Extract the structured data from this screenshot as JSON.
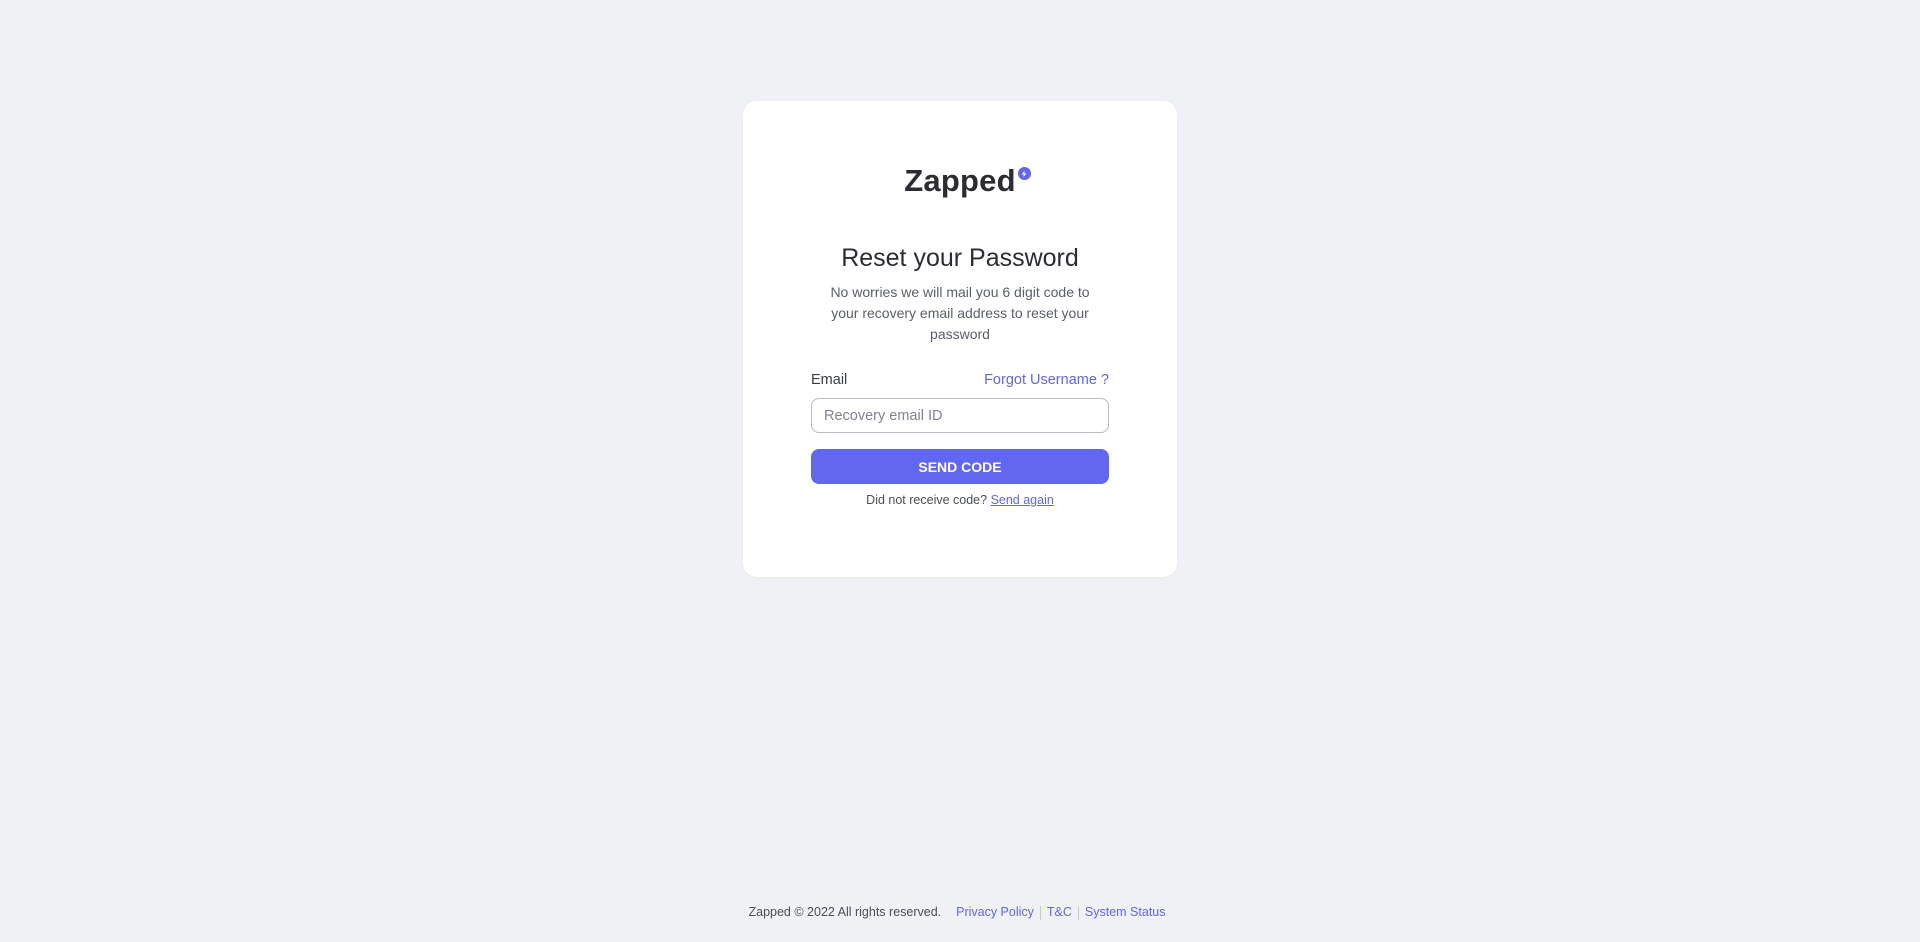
{
  "brand": {
    "name": "Zapped",
    "badge_icon": "bolt-icon",
    "accent": "#6267ea"
  },
  "reset": {
    "title": "Reset your Password",
    "description": "No worries we will mail you 6 digit code to your recovery email address to reset your password",
    "email_label": "Email",
    "forgot_username": "Forgot Username ?",
    "email_placeholder": "Recovery email ID",
    "email_value": "",
    "send_button": "SEND CODE",
    "resend_prompt": "Did not receive code?",
    "resend_link": "Send again"
  },
  "footer": {
    "copyright": "Zapped © 2022 All rights reserved.",
    "links": [
      "Privacy Policy",
      "T&C",
      "System Status"
    ]
  },
  "colors": {
    "background": "#f0f1f5",
    "card": "#ffffff",
    "primary": "#6267ef",
    "link": "#6066e8"
  }
}
